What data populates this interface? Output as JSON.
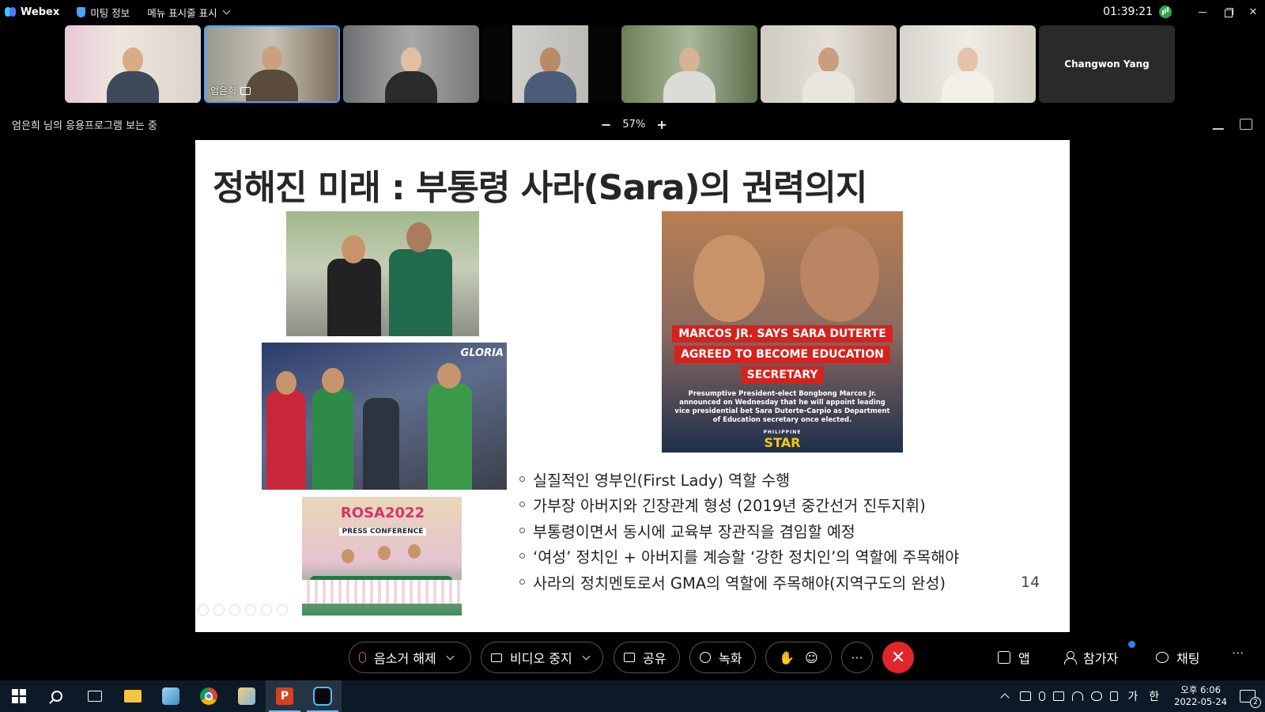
{
  "titlebar": {
    "app_name": "Webex",
    "meeting_info": "미팅 정보",
    "menu_bar": "메뉴 표시줄 표시",
    "clock": "01:39:21"
  },
  "participants": [
    {
      "name": "",
      "active": false
    },
    {
      "name": "엄은희",
      "active": true
    },
    {
      "name": "",
      "active": false
    },
    {
      "name": "",
      "active": false
    },
    {
      "name": "",
      "active": false
    },
    {
      "name": "",
      "active": false
    },
    {
      "name": "",
      "active": false
    },
    {
      "name": "Changwon Yang",
      "active": false
    }
  ],
  "sharebar": {
    "viewing_text": "엄은희 님의 응용프로그램 보는 중",
    "zoom_minus": "−",
    "zoom_level": "57%",
    "zoom_plus": "+"
  },
  "slide": {
    "title": "정해진 미래 : 부통령 사라(Sara)의 권력의지",
    "news": {
      "line1": "MARCOS JR. SAYS SARA DUTERTE",
      "line2": "AGREED TO BECOME EDUCATION",
      "line3": "SECRETARY",
      "body": "Presumptive President-elect Bongbong Marcos Jr. announced on Wednesday that he will appoint leading vice presidential bet Sara Duterte-Carpio as Department of Education secretary once elected.",
      "source_top": "PHILIPPINE",
      "source": "STAR"
    },
    "press": {
      "banner": "ROSA2022",
      "sub": "PRESS CONFERENCE"
    },
    "bullets": [
      "실질적인 영부인(First Lady) 역할 수행",
      "가부장 아버지와 긴장관계 형성 (2019년 중간선거 진두지휘)",
      "부통령이면서 동시에 교육부 장관직을 겸임할 예정",
      "‘여성’ 정치인 + 아버지를 계승할 ‘강한 정치인’의 역할에 주목해야",
      "사라의 정치멘토로서 GMA의 역할에 주목해야(지역구도의 완성)"
    ],
    "page_number": "14"
  },
  "controls": {
    "unmute": "음소거 해제",
    "stop_video": "비디오 중지",
    "share": "공유",
    "record": "녹화",
    "more": "···",
    "end": "✕",
    "apps": "앱",
    "participants": "참가자",
    "chat": "채팅",
    "overflow": "···"
  },
  "taskbar": {
    "ime_lang": "가",
    "ime_mode": "한",
    "time": "오후 6:06",
    "date": "2022-05-24",
    "notifications": "2"
  },
  "colors": {
    "accent": "#4da3ff",
    "end_call": "#e0262b",
    "news_red": "#d3231f",
    "taskbar": "#0c1a27"
  }
}
